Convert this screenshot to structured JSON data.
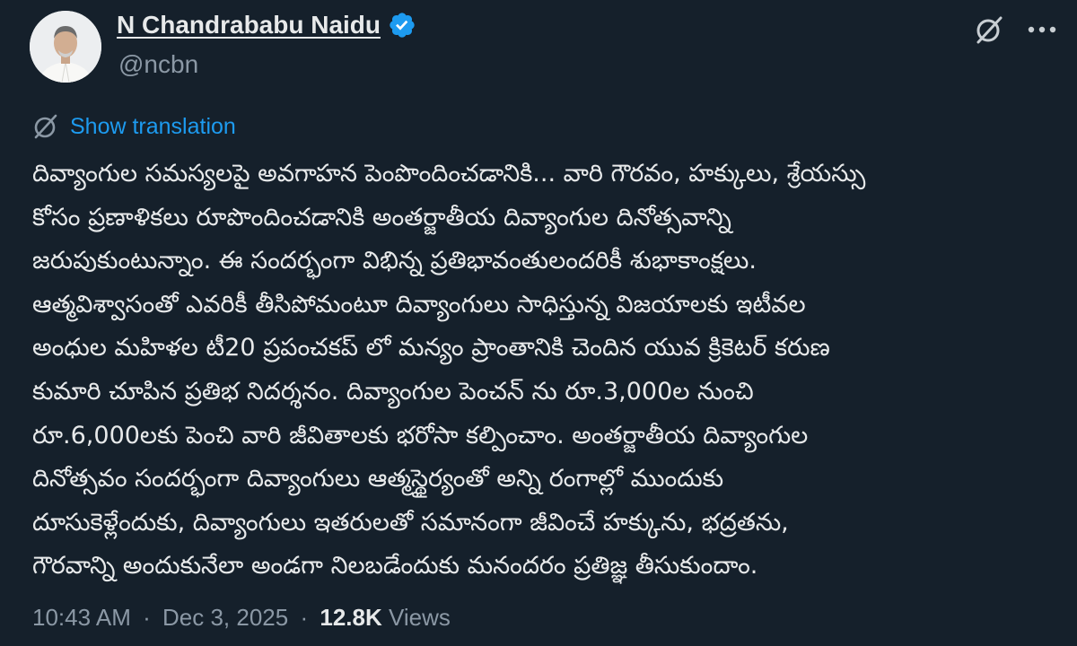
{
  "author": {
    "display_name": "N Chandrababu Naidu",
    "handle": "@ncbn",
    "verified": true
  },
  "actions": {
    "grok_icon": "grok-icon",
    "more_icon": "more-options-icon"
  },
  "translation": {
    "label": "Show translation",
    "icon": "translate-icon"
  },
  "tweet": {
    "lines": [
      "దివ్యాంగుల సమస్యలపై అవగాహన పెంపొందించడానికి... వారి గౌరవం, హక్కులు, శ్రేయస్సు",
      "కోసం ప్రణాళికలు రూపొందించడానికి  అంతర్జాతీయ దివ్యాంగుల దినోత్సవాన్ని",
      "జరుపుకుంటున్నాం. ఈ సందర్భంగా విభిన్న ప్రతిభావంతులందరికీ శుభాకాంక్షలు.",
      "ఆత్మవిశ్వాసంతో ఎవరికీ తీసిపోమంటూ  దివ్యాంగులు సాధిస్తున్న విజయాలకు ఇటీవల",
      "అంధుల మహిళల టీ20 ప్రపంచకప్ లో మన్యం ప్రాంతానికి చెందిన యువ క్రికెటర్ కరుణ",
      "కుమారి చూపిన ప్రతిభ నిదర్శనం. దివ్యాంగుల పెంచన్ ను రూ.3,000ల నుంచి",
      "రూ.6,000లకు పెంచి వారి జీవితాలకు భరోసా కల్పించాం. అంతర్జాతీయ దివ్యాంగుల",
      "దినోత్సవం సందర్భంగా దివ్యాంగులు ఆత్మస్థైర్యంతో అన్ని రంగాల్లో ముందుకు",
      "దూసుకెళ్లేందుకు, దివ్యాంగులు ఇతరులతో సమానంగా జీవించే హక్కును, భద్రతను,",
      "గౌరవాన్ని అందుకునేలా అండగా నిలబడేందుకు మనందరం ప్రతిజ్ఞ తీసుకుందాం."
    ]
  },
  "meta": {
    "time": "10:43 AM",
    "separator": "·",
    "date": "Dec 3, 2025",
    "views_count": "12.8K",
    "views_label": "Views"
  },
  "colors": {
    "background": "#15202b",
    "text": "#e7e9ea",
    "secondary": "#8b98a5",
    "accent": "#1d9bf0"
  }
}
